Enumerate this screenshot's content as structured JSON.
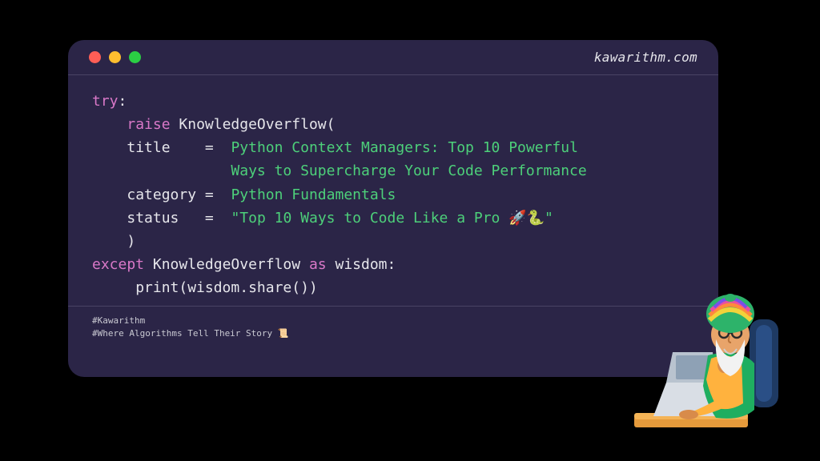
{
  "site": "kawarithm.com",
  "code": {
    "kw_try": "try",
    "colon1": ":",
    "kw_raise": "raise",
    "cls_name": "KnowledgeOverflow",
    "lp": "(",
    "p_title": "title",
    "eq": " =",
    "title_l1": "Python Context Managers: Top 10 Powerful",
    "title_l2": "Ways to Supercharge Your Code Performance",
    "p_category": "category",
    "category": "Python Fundamentals",
    "p_status": "status",
    "status": "\"Top 10 Ways to Code Like a Pro 🚀🐍\"",
    "rp": ")",
    "kw_except": "except",
    "kw_as": "as",
    "var": "wisdom",
    "colon2": ":",
    "print": "print(wisdom.share())"
  },
  "footer": {
    "l1": "#Kawarithm",
    "l2": "#Where Algorithms Tell Their Story 📜"
  }
}
